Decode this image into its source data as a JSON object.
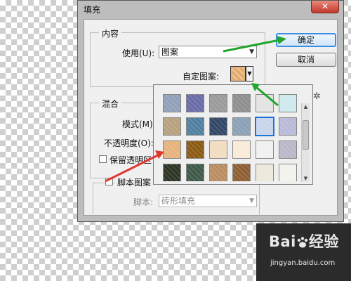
{
  "dialog": {
    "title": "填充",
    "close_icon": "close-icon",
    "ok_label": "确定",
    "cancel_label": "取消"
  },
  "contents": {
    "legend": "内容",
    "use_label": "使用(U):",
    "use_value": "图案",
    "custom_pattern_label": "自定图案:"
  },
  "blending": {
    "legend": "混合",
    "mode_label": "模式(M):",
    "opacity_label": "不透明度(O):",
    "preserve_label": "保留透明区"
  },
  "script_group": {
    "checkbox_label": "脚本图案",
    "script_label": "脚本:",
    "script_value": "砖形填充"
  },
  "pattern_picker": {
    "menu_icon": "gear-icon",
    "selected_index": 10,
    "patterns": [
      {
        "name": "bubbles",
        "color": "#8fa0b8"
      },
      {
        "name": "tie-dye",
        "color": "#6a6aa8"
      },
      {
        "name": "gray-weave",
        "color": "#9a9a9a"
      },
      {
        "name": "gray",
        "color": "#8e8e8e"
      },
      {
        "name": "white-crinkle",
        "color": "#e3e3e3"
      },
      {
        "name": "light-cyan",
        "color": "#cfe8ee"
      },
      {
        "name": "khaki",
        "color": "#b7a07e"
      },
      {
        "name": "teal-blue",
        "color": "#4f7fa0"
      },
      {
        "name": "navy-cloth",
        "color": "#2f4664"
      },
      {
        "name": "blue-gray",
        "color": "#8aa0b6"
      },
      {
        "name": "light-blue",
        "color": "#c8d4ea"
      },
      {
        "name": "light-purple",
        "color": "#b9b9d8"
      },
      {
        "name": "orange-light",
        "color": "#e6b27d"
      },
      {
        "name": "brown-orange",
        "color": "#8a5a12"
      },
      {
        "name": "light-beige",
        "color": "#f2dcc0"
      },
      {
        "name": "cream",
        "color": "#f8ebd8"
      },
      {
        "name": "white-lines",
        "color": "#f0f0f0"
      },
      {
        "name": "gray-stripes",
        "color": "#b8b8c8"
      },
      {
        "name": "dark-green",
        "color": "#2c3424"
      },
      {
        "name": "dark-teal",
        "color": "#3e5848"
      },
      {
        "name": "sand-brown",
        "color": "#b98c60"
      },
      {
        "name": "brown-wood",
        "color": "#8e5e32"
      },
      {
        "name": "white-crumpled",
        "color": "#ece8dc"
      },
      {
        "name": "white-light",
        "color": "#f4f2ec"
      }
    ]
  },
  "watermark": {
    "logo_text": "Bai",
    "logo_text2": "经验",
    "url": "jingyan.baidu.com"
  }
}
